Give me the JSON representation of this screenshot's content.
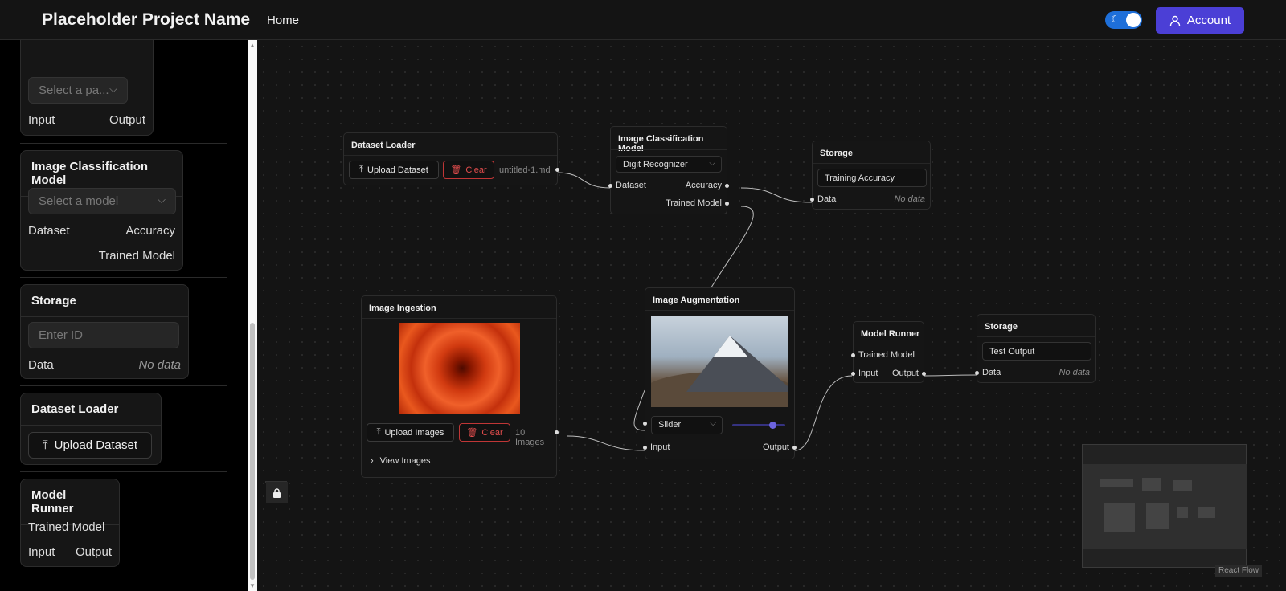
{
  "header": {
    "title": "Placeholder Project Name",
    "nav_home": "Home",
    "account_label": "Account",
    "accent_color": "#4b3fd6"
  },
  "sidebar": {
    "partial_node": {
      "select_placeholder": "Select a pa...",
      "left_port": "Input",
      "right_port": "Output"
    },
    "image_classification": {
      "title": "Image Classification Model",
      "select_placeholder": "Select a model",
      "port_dataset": "Dataset",
      "port_accuracy": "Accuracy",
      "port_trained_model": "Trained Model"
    },
    "storage": {
      "title": "Storage",
      "input_placeholder": "Enter ID",
      "port_data": "Data",
      "no_data": "No data"
    },
    "dataset_loader": {
      "title": "Dataset Loader",
      "upload_label": "Upload Dataset"
    },
    "model_runner": {
      "title": "Model Runner",
      "port_trained_model": "Trained Model",
      "port_input": "Input",
      "port_output": "Output"
    }
  },
  "canvas": {
    "dataset_loader": {
      "title": "Dataset Loader",
      "upload_label": "Upload Dataset",
      "clear_label": "Clear",
      "file_name": "untitled-1.md"
    },
    "image_classification": {
      "title": "Image Classification Model",
      "selected_model": "Digit Recognizer",
      "port_dataset": "Dataset",
      "port_accuracy": "Accuracy",
      "port_trained_model": "Trained Model"
    },
    "storage_top": {
      "title": "Storage",
      "input_value": "Training Accuracy",
      "port_data": "Data",
      "no_data": "No data"
    },
    "image_ingestion": {
      "title": "Image Ingestion",
      "upload_label": "Upload Images",
      "clear_label": "Clear",
      "image_count": "10 Images",
      "view_images": "View Images"
    },
    "image_augmentation": {
      "title": "Image Augmentation",
      "selected_mode": "Slider",
      "slider_value": 0.75,
      "port_input": "Input",
      "port_output": "Output"
    },
    "model_runner": {
      "title": "Model Runner",
      "port_trained_model": "Trained Model",
      "port_input": "Input",
      "port_output": "Output"
    },
    "storage_bottom": {
      "title": "Storage",
      "input_value": "Test Output",
      "port_data": "Data",
      "no_data": "No data"
    },
    "controls": {
      "zoom_in": "+",
      "zoom_out": "−"
    },
    "attribution": "React Flow"
  }
}
